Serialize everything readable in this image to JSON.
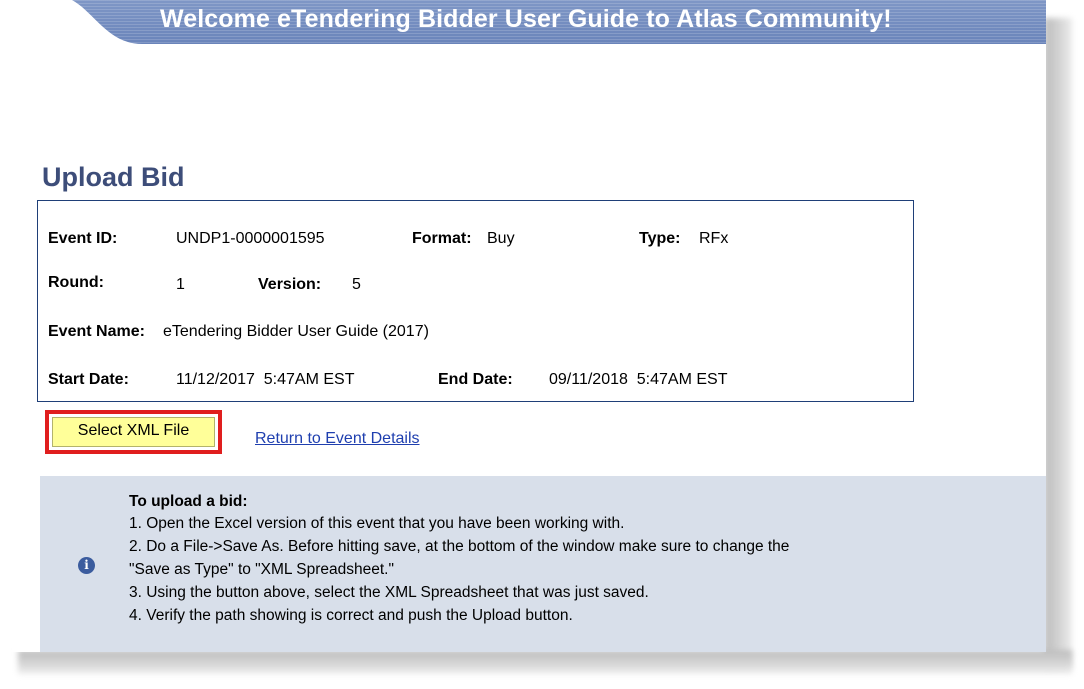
{
  "banner": {
    "title": "Welcome eTendering Bidder User Guide to Atlas Community!"
  },
  "page": {
    "title": "Upload Bid"
  },
  "event": {
    "event_id_label": "Event ID:",
    "event_id": "UNDP1-0000001595",
    "format_label": "Format:",
    "format": "Buy",
    "type_label": "Type:",
    "type": "RFx",
    "round_label": "Round:",
    "round": "1",
    "version_label": "Version:",
    "version": "5",
    "event_name_label": "Event Name:",
    "event_name": "eTendering Bidder User Guide (2017)",
    "start_date_label": "Start Date:",
    "start_date": "11/12/2017  5:47AM EST",
    "end_date_label": "End Date:",
    "end_date": "09/11/2018  5:47AM EST"
  },
  "actions": {
    "select_xml_label": "Select XML File",
    "return_link_label": "Return to Event Details"
  },
  "info": {
    "icon": "info-icon",
    "title": "To upload a bid:",
    "steps": [
      "1. Open the Excel version of this event that you have been working with.",
      "2. Do a File->Save As. Before hitting save, at the bottom of the window make sure to change the",
      "\"Save as Type\" to \"XML Spreadsheet.\"",
      "3. Using the button above, select the XML Spreadsheet that was just saved.",
      "4. Verify the path showing is correct and push the Upload button."
    ]
  },
  "colors": {
    "banner": "#6f88bd",
    "title": "#3d4d79",
    "box_border": "#1f3f78",
    "button_highlight": "#e01e1e",
    "button_fill": "#ffff99",
    "link": "#1f3faf",
    "info_panel": "#d8dfea",
    "info_icon": "#3b5c9e"
  }
}
